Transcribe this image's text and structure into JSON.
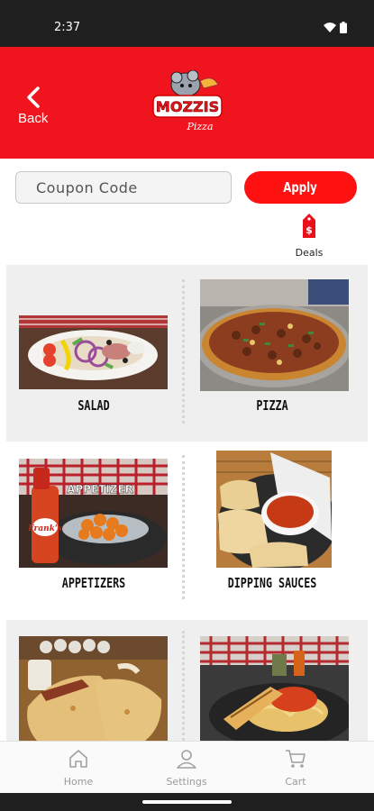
{
  "status": {
    "time": "2:37",
    "wifi_icon": "wifi-icon",
    "battery_icon": "battery-icon"
  },
  "header": {
    "back_label": "Back",
    "logo_text": "MOZZIS",
    "logo_subtext": "Pizza"
  },
  "coupon": {
    "placeholder": "Coupon Code",
    "apply_label": "Apply"
  },
  "deals": {
    "label": "Deals",
    "icon": "price-tag-icon"
  },
  "categories": [
    {
      "label": "SALAD",
      "icon": "salad-photo"
    },
    {
      "label": "PIZZA",
      "icon": "pizza-photo"
    },
    {
      "label": "APPETIZERS",
      "icon": "appetizers-photo",
      "photo_caption": "APPETIZER"
    },
    {
      "label": "DIPPING SAUCES",
      "icon": "dipping-sauces-photo"
    },
    {
      "label": "",
      "icon": "calzone-photo"
    },
    {
      "label": "",
      "icon": "spaghetti-photo"
    }
  ],
  "bottom_nav": [
    {
      "label": "Home",
      "icon": "home-icon"
    },
    {
      "label": "Settings",
      "icon": "user-icon"
    },
    {
      "label": "Cart",
      "icon": "cart-icon"
    }
  ],
  "colors": {
    "brand_red": "#f0141e",
    "apply_red": "#ff1111",
    "status_bar": "#1f1f1f",
    "panel_gray": "#efefef"
  }
}
